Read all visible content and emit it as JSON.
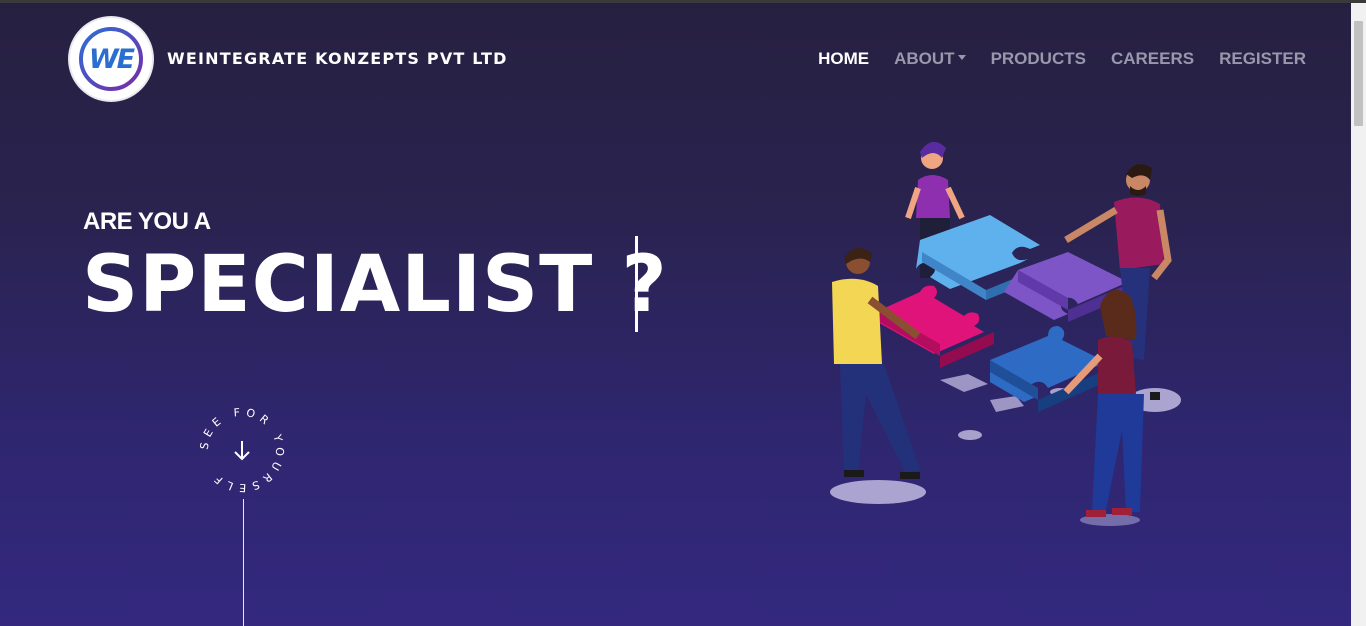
{
  "brand": {
    "logo_text": "WE",
    "name": "WEINTEGRATE KONZEPTS PVT LTD"
  },
  "nav": {
    "items": [
      {
        "label": "HOME",
        "active": true
      },
      {
        "label": "ABOUT",
        "active": false,
        "dropdown": true
      },
      {
        "label": "PRODUCTS",
        "active": false
      },
      {
        "label": "CAREERS",
        "active": false
      },
      {
        "label": "REGISTER",
        "active": false
      }
    ]
  },
  "hero": {
    "small_text": "ARE YOU A",
    "big_text": "SPECIALIST ?"
  },
  "scroll_badge": {
    "text": "SEE FOR YOURSELF",
    "icon": "arrow-down-icon"
  },
  "illustration": {
    "icon": "team-puzzle-illustration"
  },
  "colors": {
    "bg_top": "#262040",
    "bg_bottom": "#33287e",
    "nav_active": "#ffffff",
    "nav_inactive": "#9a97ad"
  }
}
